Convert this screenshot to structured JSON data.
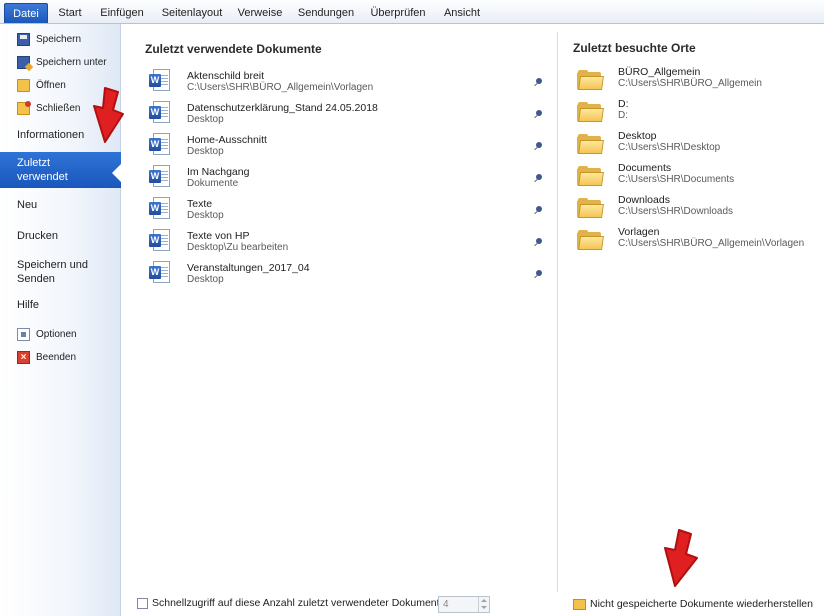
{
  "ribbon": {
    "tabs": [
      {
        "label": "Datei",
        "active": true
      },
      {
        "label": "Start"
      },
      {
        "label": "Einfügen"
      },
      {
        "label": "Seitenlayout"
      },
      {
        "label": "Verweise"
      },
      {
        "label": "Sendungen"
      },
      {
        "label": "Überprüfen"
      },
      {
        "label": "Ansicht"
      }
    ]
  },
  "backstage_nav": {
    "commands": [
      {
        "label": "Speichern",
        "icon": "save-icon"
      },
      {
        "label": "Speichern unter",
        "icon": "save-as-icon"
      },
      {
        "label": "Öffnen",
        "icon": "open-folder-icon"
      },
      {
        "label": "Schließen",
        "icon": "close-folder-icon"
      }
    ],
    "tabs": [
      {
        "label": "Informationen"
      },
      {
        "label_line1": "Zuletzt",
        "label_line2": "verwendet",
        "active": true
      },
      {
        "label": "Neu"
      },
      {
        "label": "Drucken"
      },
      {
        "label_line1": "Speichern und",
        "label_line2": "Senden"
      },
      {
        "label": "Hilfe"
      }
    ],
    "bottom_commands": [
      {
        "label": "Optionen",
        "icon": "options-icon"
      },
      {
        "label": "Beenden",
        "icon": "exit-icon"
      }
    ]
  },
  "recent_documents": {
    "title": "Zuletzt verwendete Dokumente",
    "items": [
      {
        "name": "Aktenschild breit",
        "path": "C:\\Users\\SHR\\BÜRO_Allgemein\\Vorlagen"
      },
      {
        "name": "Datenschutzerklärung_Stand 24.05.2018",
        "path": "Desktop"
      },
      {
        "name": "Home-Ausschnitt",
        "path": "Desktop"
      },
      {
        "name": "Im Nachgang",
        "path": "Dokumente"
      },
      {
        "name": "Texte",
        "path": "Desktop"
      },
      {
        "name": "Texte von HP",
        "path": "Desktop\\Zu bearbeiten"
      },
      {
        "name": "Veranstaltungen_2017_04",
        "path": "Desktop"
      }
    ]
  },
  "recent_places": {
    "title": "Zuletzt besuchte Orte",
    "items": [
      {
        "name": "BÜRO_Allgemein",
        "path": "C:\\Users\\SHR\\BÜRO_Allgemein"
      },
      {
        "name": "D:",
        "path": "D:"
      },
      {
        "name": "Desktop",
        "path": "C:\\Users\\SHR\\Desktop"
      },
      {
        "name": "Documents",
        "path": "C:\\Users\\SHR\\Documents"
      },
      {
        "name": "Downloads",
        "path": "C:\\Users\\SHR\\Downloads"
      },
      {
        "name": "Vorlagen",
        "path": "C:\\Users\\SHR\\BÜRO_Allgemein\\Vorlagen"
      }
    ]
  },
  "footer": {
    "quick_access_label": "Schnellzugriff auf diese Anzahl zuletzt verwendeter Dokumente:",
    "quick_access_checked": false,
    "quick_access_count": "4",
    "restore_label": "Nicht gespeicherte Dokumente wiederherstellen"
  },
  "colors": {
    "active_tab": "#1c58b8",
    "annotation_arrow": "#e02020"
  }
}
